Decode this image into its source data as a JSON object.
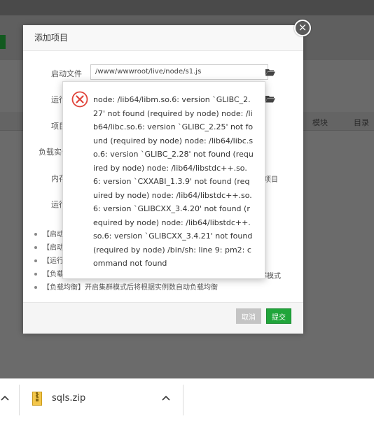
{
  "background": {
    "table_headers": [
      "模块",
      "目录"
    ]
  },
  "modal": {
    "title": "添加项目",
    "labels": {
      "start_file": "启动文件",
      "run": "运行",
      "project": "项目",
      "load_instance": "负载实例",
      "inner": "内存",
      "run2": "运行"
    },
    "start_file_value": "/www/wwwroot/live/node/s1.js",
    "side_text": "项目",
    "tips": [
      "【启动",
      "【启动",
      "【运行",
      "【负载",
      "【负载均衡】开启集群模式后将根据实例数自动负载均衡"
    ],
    "tip4_tail": "群模式",
    "cancel_label": "取消",
    "submit_label": "提交",
    "close_glyph": "×"
  },
  "error": {
    "message": "node: /lib64/libm.so.6: version `GLIBC_2.27' not found (required by node) node: /lib64/libc.so.6: version `GLIBC_2.25' not found (required by node) node: /lib64/libc.so.6: version `GLIBC_2.28' not found (required by node) node: /lib64/libstdc++.so.6: version `CXXABI_1.3.9' not found (required by node) node: /lib64/libstdc++.so.6: version `GLIBCXX_3.4.20' not found (required by node) node: /lib64/libstdc++.so.6: version `GLIBCXX_3.4.21' not found (required by node) /bin/sh: line 9: pm2: command not found"
  },
  "download_bar": {
    "file_name": "sqls.zip"
  },
  "colors": {
    "accent_green": "#20a53a",
    "error_red": "#e0443a"
  }
}
